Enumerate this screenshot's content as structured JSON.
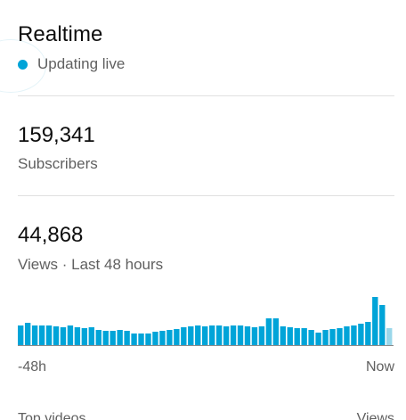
{
  "realtime": {
    "title": "Realtime",
    "status": "Updating live",
    "status_color": "#00a4d8"
  },
  "subscribers": {
    "value": "159,341",
    "label": "Subscribers"
  },
  "views": {
    "value": "44,868",
    "label": "Views · Last 48 hours"
  },
  "chart_data": {
    "type": "bar",
    "x_start_label": "-48h",
    "x_end_label": "Now",
    "bar_color": "#00a4d8",
    "current_bar_color": "#9ad7ea",
    "ylim": [
      0,
      55
    ],
    "values": [
      22,
      25,
      22,
      22,
      22,
      21,
      20,
      22,
      20,
      19,
      20,
      17,
      16,
      16,
      17,
      16,
      13,
      13,
      13,
      15,
      16,
      17,
      18,
      20,
      21,
      22,
      21,
      22,
      22,
      21,
      22,
      22,
      21,
      20,
      21,
      30,
      30,
      21,
      20,
      19,
      19,
      17,
      14,
      17,
      18,
      19,
      21,
      22,
      24,
      26,
      54,
      45,
      19
    ]
  },
  "footer": {
    "left_label": "Top videos",
    "right_label": "Views"
  }
}
